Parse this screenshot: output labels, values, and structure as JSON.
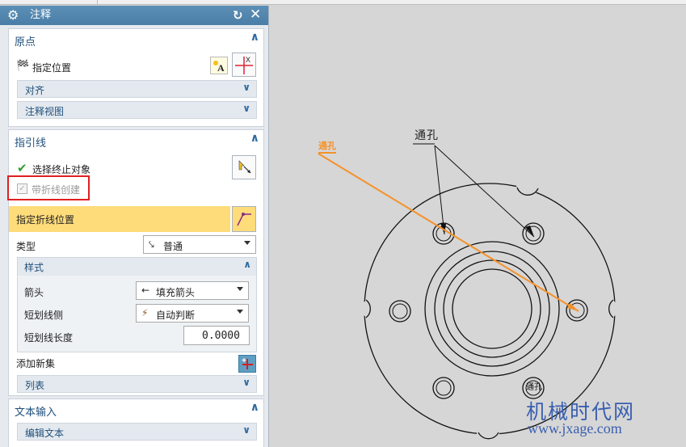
{
  "dialog": {
    "title": "注释",
    "icons": {
      "settings": "gear-icon",
      "reset": "reset-icon",
      "close": "close-icon"
    }
  },
  "origin": {
    "title": "原点",
    "specify_location": "指定位置",
    "alignment": "对齐",
    "annotation_view": "注释视图"
  },
  "leader": {
    "title": "指引线",
    "select_terminating_object": "选择终止对象",
    "create_with_jog": "带折线创建",
    "specify_jog_location": "指定折线位置",
    "type_label": "类型",
    "type_value": "普通",
    "style": {
      "title": "样式",
      "arrowhead_label": "箭头",
      "arrowhead_value": "填充箭头",
      "stub_side_label": "短划线侧",
      "stub_side_value": "自动判断",
      "stub_length_label": "短划线长度",
      "stub_length_value": "0.0000"
    },
    "add_new_set": "添加新集",
    "list": "列表"
  },
  "text_input": {
    "title": "文本输入",
    "edit_text": "编辑文本"
  },
  "drawing": {
    "annotation_text": "通孔",
    "preview_text": "通孔",
    "hole_label": "通孔",
    "watermark_cn": "机械时代网",
    "watermark_url": "www.jxage.com"
  },
  "colors": {
    "titlebar": "#4f83ab",
    "section_title": "#1f4f7a",
    "highlight_row": "#fedc7a",
    "red_box": "#e02020",
    "leader_orange": "#f5922a",
    "checkmark_green": "#2ea02e",
    "watermark": "#3a5fb0"
  }
}
